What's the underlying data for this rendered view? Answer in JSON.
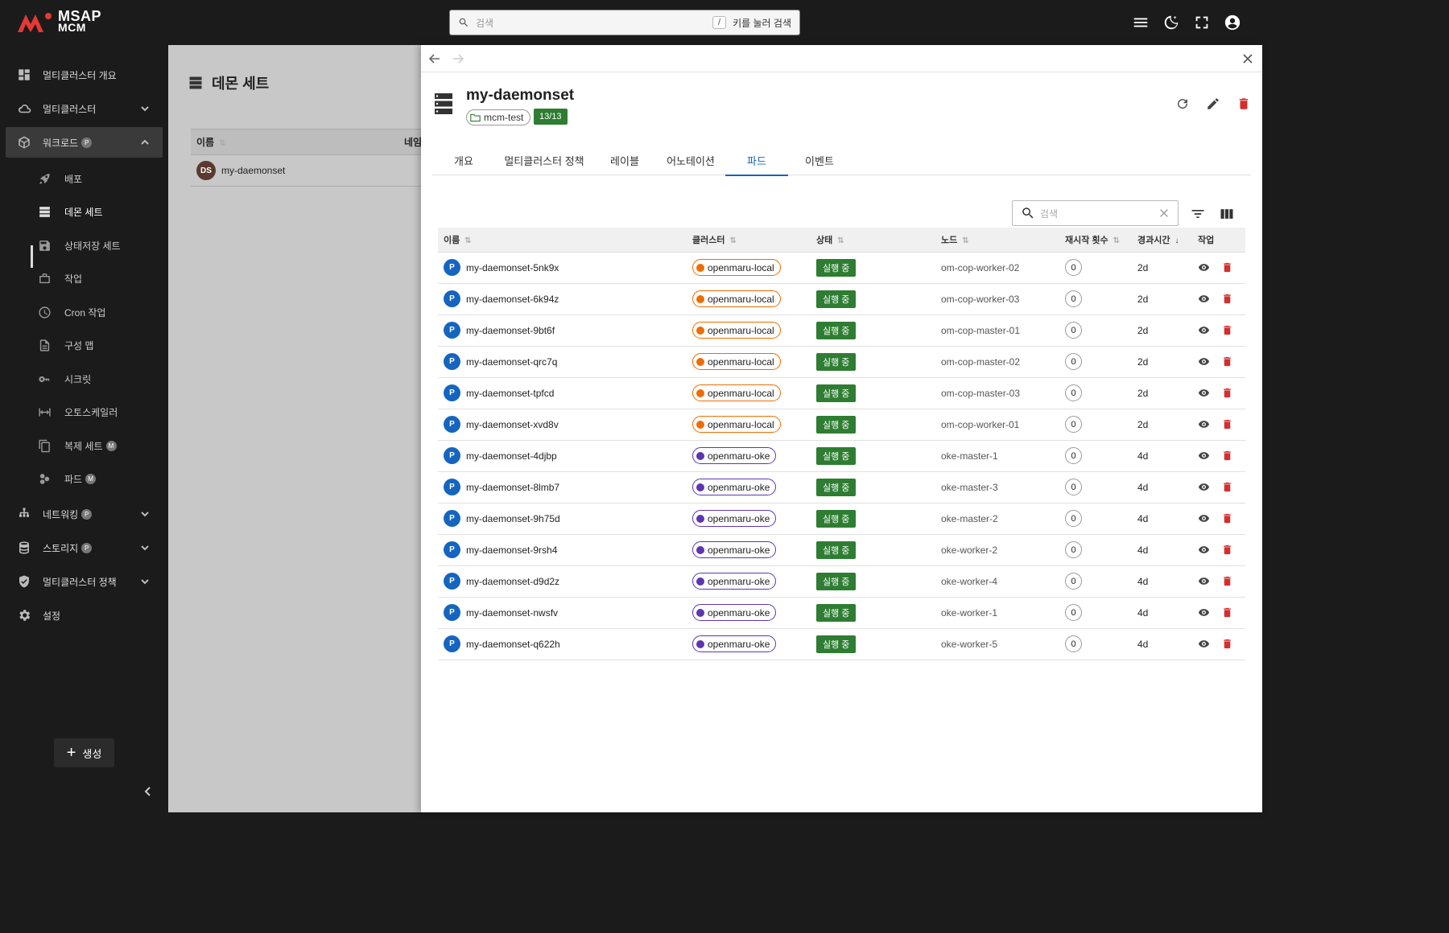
{
  "brand": {
    "line1": "MSAP",
    "line2": "MCM",
    "accent": "#e53935"
  },
  "top_search": {
    "placeholder": "검색",
    "kbd": "/",
    "hint": "키를 눌러 검색"
  },
  "sidebar": {
    "items": [
      {
        "label": "멀티클러스터 개요"
      },
      {
        "label": "멀티클러스터"
      },
      {
        "label": "워크로드",
        "badge": "P"
      },
      {
        "label": "네트워킹",
        "badge": "P"
      },
      {
        "label": "스토리지",
        "badge": "P"
      },
      {
        "label": "멀티클러스터 정책"
      },
      {
        "label": "설정"
      }
    ],
    "sub_items": [
      {
        "label": "배포"
      },
      {
        "label": "데몬 세트"
      },
      {
        "label": "상태저장 세트"
      },
      {
        "label": "작업"
      },
      {
        "label": "Cron 작업"
      },
      {
        "label": "구성 맵"
      },
      {
        "label": "시크릿"
      },
      {
        "label": "오토스케일러"
      },
      {
        "label": "복제 세트",
        "badge": "M"
      },
      {
        "label": "파드",
        "badge": "M"
      }
    ],
    "create_label": "생성"
  },
  "background_page": {
    "title": "데몬 세트",
    "col_name": "이름",
    "col_ns": "네임",
    "row_avatar": "DS",
    "row_name": "my-daemonset"
  },
  "drawer": {
    "resource_name": "my-daemonset",
    "namespace": "mcm-test",
    "ready": "13/13",
    "tabs": [
      "개요",
      "멀티클러스터 정책",
      "레이블",
      "어노테이션",
      "파드",
      "이벤트"
    ],
    "active_tab": "파드",
    "table_search_placeholder": "검색",
    "columns": [
      "이름",
      "클러스터",
      "상태",
      "노드",
      "재시작 횟수",
      "경과시간",
      "작업"
    ],
    "pods": [
      {
        "name": "my-daemonset-5nk9x",
        "cluster": "openmaru-local",
        "kind": "local",
        "status": "실행 중",
        "node": "om-cop-worker-02",
        "restarts": "0",
        "age": "2d"
      },
      {
        "name": "my-daemonset-6k94z",
        "cluster": "openmaru-local",
        "kind": "local",
        "status": "실행 중",
        "node": "om-cop-worker-03",
        "restarts": "0",
        "age": "2d"
      },
      {
        "name": "my-daemonset-9bt6f",
        "cluster": "openmaru-local",
        "kind": "local",
        "status": "실행 중",
        "node": "om-cop-master-01",
        "restarts": "0",
        "age": "2d"
      },
      {
        "name": "my-daemonset-qrc7q",
        "cluster": "openmaru-local",
        "kind": "local",
        "status": "실행 중",
        "node": "om-cop-master-02",
        "restarts": "0",
        "age": "2d"
      },
      {
        "name": "my-daemonset-tpfcd",
        "cluster": "openmaru-local",
        "kind": "local",
        "status": "실행 중",
        "node": "om-cop-master-03",
        "restarts": "0",
        "age": "2d"
      },
      {
        "name": "my-daemonset-xvd8v",
        "cluster": "openmaru-local",
        "kind": "local",
        "status": "실행 중",
        "node": "om-cop-worker-01",
        "restarts": "0",
        "age": "2d"
      },
      {
        "name": "my-daemonset-4djbp",
        "cluster": "openmaru-oke",
        "kind": "oke",
        "status": "실행 중",
        "node": "oke-master-1",
        "restarts": "0",
        "age": "4d"
      },
      {
        "name": "my-daemonset-8lmb7",
        "cluster": "openmaru-oke",
        "kind": "oke",
        "status": "실행 중",
        "node": "oke-master-3",
        "restarts": "0",
        "age": "4d"
      },
      {
        "name": "my-daemonset-9h75d",
        "cluster": "openmaru-oke",
        "kind": "oke",
        "status": "실행 중",
        "node": "oke-master-2",
        "restarts": "0",
        "age": "4d"
      },
      {
        "name": "my-daemonset-9rsh4",
        "cluster": "openmaru-oke",
        "kind": "oke",
        "status": "실행 중",
        "node": "oke-worker-2",
        "restarts": "0",
        "age": "4d"
      },
      {
        "name": "my-daemonset-d9d2z",
        "cluster": "openmaru-oke",
        "kind": "oke",
        "status": "실행 중",
        "node": "oke-worker-4",
        "restarts": "0",
        "age": "4d"
      },
      {
        "name": "my-daemonset-nwsfv",
        "cluster": "openmaru-oke",
        "kind": "oke",
        "status": "실행 중",
        "node": "oke-worker-1",
        "restarts": "0",
        "age": "4d"
      },
      {
        "name": "my-daemonset-q622h",
        "cluster": "openmaru-oke",
        "kind": "oke",
        "status": "실행 중",
        "node": "oke-worker-5",
        "restarts": "0",
        "age": "4d"
      }
    ],
    "pod_avatar": "P"
  },
  "colors": {
    "primary": "#1565c0",
    "running": "#2e7d32",
    "delete": "#d32f2f",
    "local": "#ef6c00",
    "oke": "#5e35b1"
  }
}
